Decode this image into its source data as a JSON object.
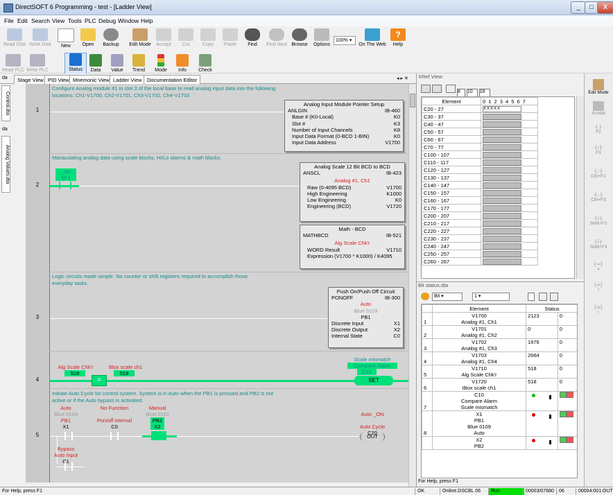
{
  "window": {
    "title": "DirectSOFT 6 Programming - test - [Ladder View]",
    "min": "_",
    "max": "□",
    "close": "X"
  },
  "menu": [
    "File",
    "Edit",
    "Search",
    "View",
    "Tools",
    "PLC",
    "Debug",
    "Window",
    "Help"
  ],
  "toolbar1": [
    {
      "label": "Read Disk",
      "dis": true
    },
    {
      "label": "Write Disk",
      "dis": true
    },
    {
      "label": "New"
    },
    {
      "label": "Open"
    },
    {
      "label": "Backup"
    },
    {
      "label": "Edit Mode"
    },
    {
      "label": "Accept",
      "dis": true
    },
    {
      "label": "Cut",
      "dis": true
    },
    {
      "label": "Copy",
      "dis": true
    },
    {
      "label": "Paste",
      "dis": true
    },
    {
      "label": "Find"
    },
    {
      "label": "Find Next",
      "dis": true
    },
    {
      "label": "Browse"
    },
    {
      "label": "Options"
    },
    {
      "label": "On The Web"
    },
    {
      "label": "Help"
    }
  ],
  "zoom": "100%",
  "toolbar2": [
    {
      "label": "Read PLC",
      "dis": true
    },
    {
      "label": "Write PLC",
      "dis": true
    },
    {
      "label": "Status",
      "sel": true
    },
    {
      "label": "Data"
    },
    {
      "label": "Value"
    },
    {
      "label": "Trend"
    },
    {
      "label": "Mode"
    },
    {
      "label": "Info"
    },
    {
      "label": "Check"
    }
  ],
  "tabs": [
    "Stage View",
    "PID View",
    "Mnemonic View",
    "Ladder View",
    "Documentation Editor"
  ],
  "tab_nav": "◂ ▸ ✕",
  "side_tabs": [
    "Control.dta",
    "Analog Values.dta"
  ],
  "side_icons": [
    "da",
    "da"
  ],
  "rungs": {
    "r1": {
      "num": "1",
      "comment": "Configure Analog module #1 in slot 3 of the local base to read analog input data into the following locations: Ch1-V1700, Ch2-V1701, Ch3-V1702, Ch4-V1703",
      "box": {
        "title": "Analog Input Module Pointer Setup",
        "name": "ANLGIN",
        "code": "IB-460",
        "rows": [
          [
            "Base # (K0-Local)",
            "K0"
          ],
          [
            "Slot #",
            "K3"
          ],
          [
            "Number of Input Channels",
            "K8"
          ],
          [
            "Input Data Format (0-BCD 1-BIN)",
            "K0"
          ],
          [
            "Input Data Address",
            "V1700"
          ]
        ]
      }
    },
    "r2": {
      "num": "2",
      "comment": "Manipulating analog data using scale blocks, Hi/Lo alarms & math blocks.",
      "contact": {
        "name": "_On",
        "addr": "SP1"
      },
      "box1": {
        "title": "Analog Scale 12 Bit BCD to BCD",
        "name": "ANSCL",
        "code": "IB-423",
        "sub": "Analog #1, Ch1",
        "rows": [
          [
            "Raw (0-4095 BCD)",
            "V1700"
          ],
          [
            "High Engineering",
            "K1000"
          ],
          [
            "Low Engineering",
            "K0"
          ],
          [
            "Engineering (BCD)",
            "V1720"
          ]
        ]
      },
      "box2": {
        "title": "Math - BCD",
        "name": "MATHBCD",
        "code": "IB-521",
        "sub": "Alg Scale Chk'r",
        "rows": [
          [
            "WORD Result",
            "V1710"
          ],
          [
            "Expression  (V1700 * K1000) / K4095",
            ""
          ]
        ]
      }
    },
    "r3": {
      "num": "3",
      "comment": "Logic circuits made simple. No counter or shift registers required to accomplish those everyday tasks.",
      "box": {
        "title": "Push On/Push Off Circuit",
        "name": "PONOFF",
        "code": "IB-300",
        "n1": "Auto",
        "n2": "Blue 0109",
        "n3": "PB1",
        "rows": [
          [
            "Discrete Input",
            "X1"
          ],
          [
            "Discrete Output",
            "X2"
          ],
          [
            "Internal State",
            "C0"
          ]
        ]
      }
    },
    "r4": {
      "num": "4",
      "a_label": "Alg Scale Chk'r",
      "a_val": "518",
      "b_label": "IBox scale ch1",
      "b_val": "518",
      "eq": "=",
      "coil_n1": "Scale mismatch",
      "coil_n2": "Compare Alarm",
      "coil_addr": "C10",
      "coil_op": "SET"
    },
    "r5": {
      "num": "5",
      "comment": "Initiate Auto Cycle for control system. System is in Auto when the PB1 is pressed and PB2 is not active or if the Auto bypass is activated.",
      "c1": {
        "n1": "Auto",
        "n2": "Blue 0109",
        "n3": "PB1",
        "addr": "X1"
      },
      "c2": {
        "n1": "No Function",
        "n3": "Pon/off internal",
        "addr": "C0"
      },
      "c3": {
        "n1": "Manual",
        "n2": "Blue 0110",
        "n3": "PB2",
        "addr": "X2"
      },
      "c4": {
        "n1": "Bypass",
        "n2": "Auto Input",
        "addr": "C1"
      },
      "coil": {
        "n1": "Auto _ON",
        "n2": "Auto Cycle",
        "addr": "C20",
        "op": "OUT"
      }
    }
  },
  "xref": {
    "title": "XRef View",
    "buttons": [
      "8",
      "10",
      "16"
    ],
    "header_el": "Element",
    "header_bits": "0 1 2 3 4 5 6 7",
    "c20_bits": "XXXXX",
    "rows": [
      "C20 - 27",
      "C30 - 37",
      "C40 - 47",
      "C50 - 57",
      "C60 - 67",
      "C70 - 77",
      "C100 - 107",
      "C110 - 117",
      "C120 - 127",
      "C130 - 137",
      "C140 - 147",
      "C150 - 157",
      "C160 - 167",
      "C170 - 177",
      "C200 - 207",
      "C210 - 217",
      "C220 - 227",
      "C230 - 237",
      "C240 - 247",
      "C250 - 257",
      "C260 - 267"
    ]
  },
  "bitstatus": {
    "title": "Bit status.dta",
    "sel1": "Bit",
    "sel2": "1",
    "headers": [
      "Element",
      "Status"
    ],
    "rows": [
      {
        "n": "1",
        "a": "V1700",
        "b": "Analog #1, Ch1",
        "s": "2123",
        "v": "0"
      },
      {
        "n": "2",
        "a": "V1701",
        "b": "Analog #1, Ch2",
        "s": "0",
        "v": "0"
      },
      {
        "n": "3",
        "a": "V1702",
        "b": "Analog #1, Ch3",
        "s": "1976",
        "v": "0"
      },
      {
        "n": "4",
        "a": "V1703",
        "b": "Analog #1, Ch4",
        "s": "2664",
        "v": "0"
      },
      {
        "n": "5",
        "a": "V1710",
        "b": "Alg Scale Chk'r",
        "s": "518",
        "v": "0"
      },
      {
        "n": "6",
        "a": "V1720",
        "b": "IBox scale ch1",
        "s": "518",
        "v": "0"
      }
    ],
    "bitrows": [
      {
        "n": "7",
        "a": "C10",
        "b": "Compare Alarm",
        "c": "Scale mismatch",
        "dot": "#00c000"
      },
      {
        "n": "8",
        "a": "X1",
        "b": "PB1",
        "c": "Blue 0109",
        "d": "Auto",
        "dot": "#e00000"
      },
      {
        "n": "",
        "a": "X2",
        "b": "PB2",
        "dot": "#e00000"
      }
    ],
    "help": "For Help, press F1"
  },
  "righttools": [
    {
      "label": "Edit Mode",
      "on": true
    },
    {
      "label": "Accept"
    },
    {
      "label": "F2"
    },
    {
      "label": "F3"
    },
    {
      "label": "Ctrl+F2"
    },
    {
      "label": "Ctrl+F3"
    },
    {
      "label": "Shift+F2"
    },
    {
      "label": "Shift+F3"
    },
    {
      "label": "="
    },
    {
      "label": "!"
    },
    {
      "label": "~"
    }
  ],
  "status": {
    "help": "For Help, press F1",
    "ok": "OK",
    "online": "Online.DSCBL 06",
    "run": "Run",
    "mem": "00003/07680",
    "cpu": "06",
    "addr": "00004:001:OUT"
  }
}
